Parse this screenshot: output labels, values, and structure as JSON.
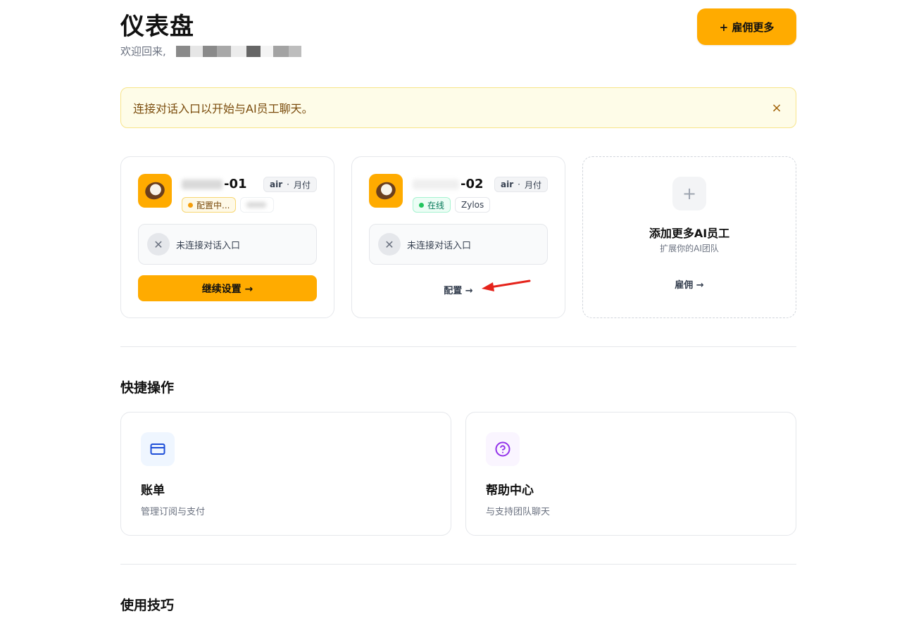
{
  "header": {
    "title": "仪表盘",
    "welcome": "欢迎回来,",
    "hire_button": "+ 雇佣更多"
  },
  "banner": {
    "text": "连接对话入口以开始与AI员工聊天。",
    "close_icon": "×"
  },
  "agents": [
    {
      "name_suffix": "-01",
      "plan_tier": "air",
      "plan_billing": "月付",
      "status_label": "配置中...",
      "connection_text": "未连接对话入口",
      "action_label": "继续设置 →"
    },
    {
      "name_suffix": "-02",
      "plan_tier": "air",
      "plan_billing": "月付",
      "status_label": "在线",
      "platform_label": "Zylos",
      "connection_text": "未连接对话入口",
      "action_label": "配置 →"
    }
  ],
  "add_card": {
    "plus": "+",
    "title": "添加更多AI员工",
    "subtitle": "扩展你的AI团队",
    "link": "雇佣 →"
  },
  "quick_actions": {
    "title": "快捷操作",
    "items": [
      {
        "title": "账单",
        "subtitle": "管理订阅与支付",
        "icon": "credit-card-icon",
        "color": "#1d4ed8"
      },
      {
        "title": "帮助中心",
        "subtitle": "与支持团队聊天",
        "icon": "help-circle-icon",
        "color": "#9333ea"
      }
    ]
  },
  "tips": {
    "title": "使用技巧"
  },
  "colors": {
    "accent": "#ffab00",
    "banner_bg": "#fefce8",
    "online": "#22c55e",
    "configuring": "#f59e0b",
    "annotation_arrow": "#e5231b"
  }
}
